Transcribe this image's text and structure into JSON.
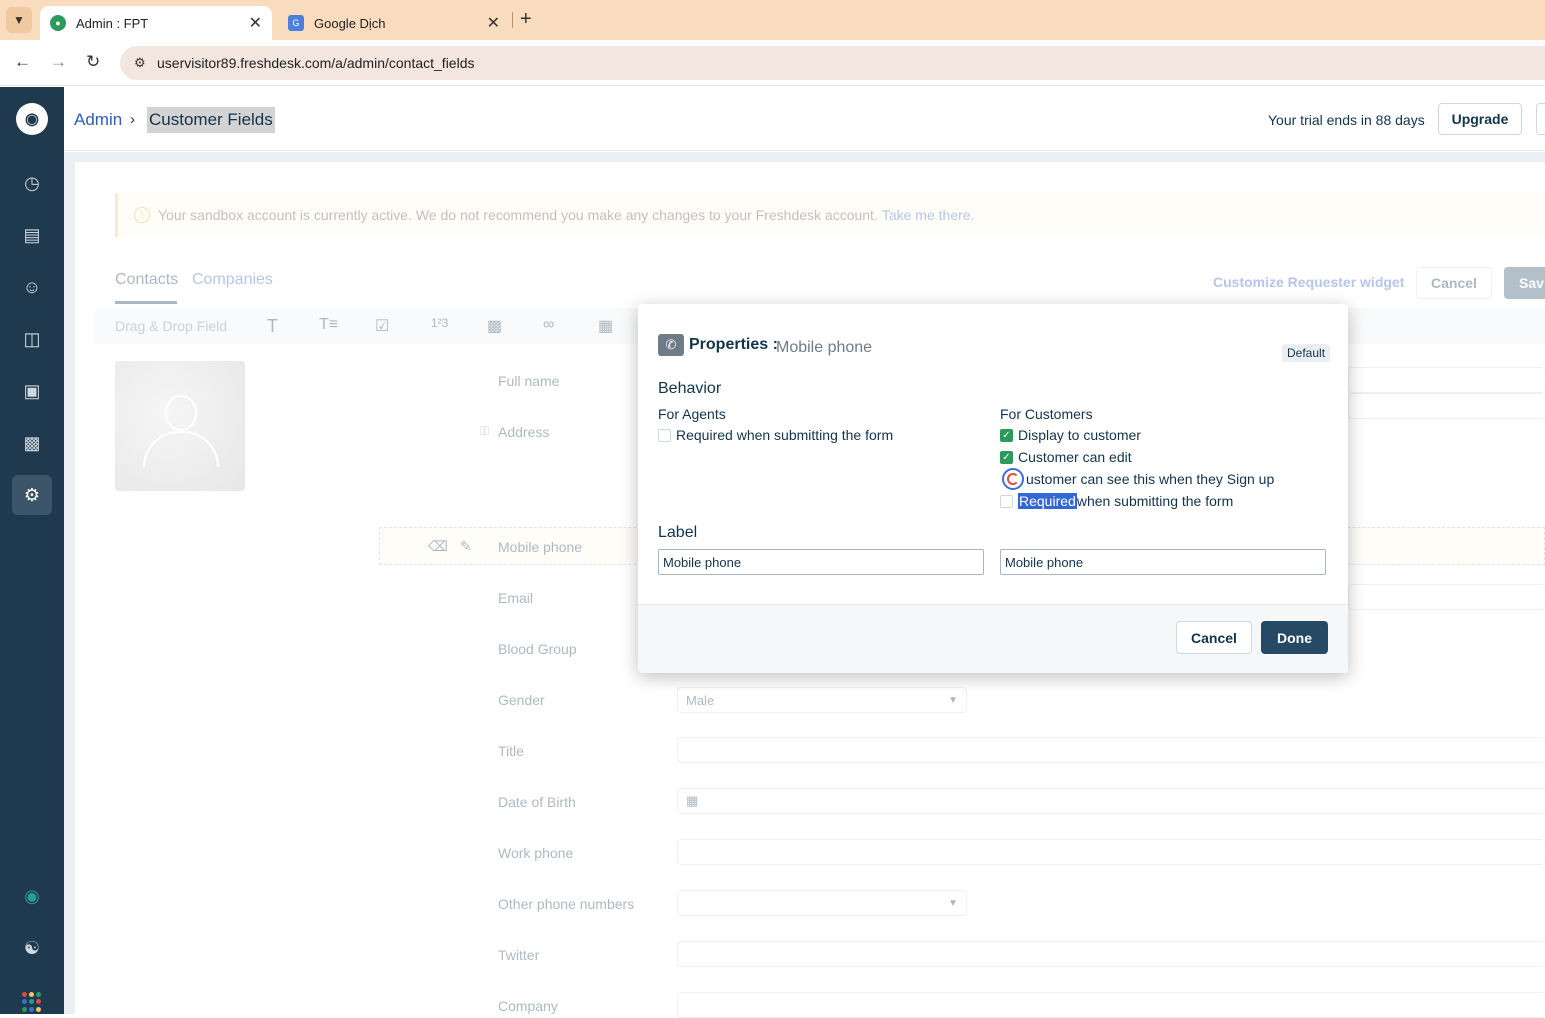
{
  "browser": {
    "tabs": [
      {
        "title": "Admin : FPT"
      },
      {
        "title": "Google Dịch"
      }
    ],
    "url": "uservisitor89.freshdesk.com/a/admin/contact_fields"
  },
  "header": {
    "breadcrumb_root": "Admin",
    "breadcrumb_current": "Customer Fields",
    "trial_text": "Your trial ends in 88 days",
    "upgrade_label": "Upgrade"
  },
  "sandbox_banner": {
    "text": "Your sandbox account is currently active. We do not recommend you make any changes to your Freshdesk account.",
    "link": "Take me there."
  },
  "tabs": {
    "contacts": "Contacts",
    "companies": "Companies"
  },
  "actions": {
    "customize_widget": "Customize Requester widget",
    "cancel": "Cancel",
    "save": "Sav"
  },
  "toolbar": {
    "drag_drop_label": "Drag & Drop Field"
  },
  "fields": [
    {
      "label": "Full name"
    },
    {
      "label": "Address"
    },
    {
      "label": "Mobile phone"
    },
    {
      "label": "Email"
    },
    {
      "label": "Blood Group"
    },
    {
      "label": "Gender",
      "value": "Male"
    },
    {
      "label": "Title"
    },
    {
      "label": "Date of Birth"
    },
    {
      "label": "Work phone"
    },
    {
      "label": "Other phone numbers"
    },
    {
      "label": "Twitter"
    },
    {
      "label": "Company"
    }
  ],
  "modal": {
    "title": "Properties :",
    "subtitle": "Mobile phone",
    "badge": "Default",
    "behavior_heading": "Behavior",
    "for_agents": "For Agents",
    "for_customers": "For Customers",
    "agent_required": "Required when submitting the form",
    "display_to_customer": "Display to customer",
    "customer_can_edit": "Customer can edit",
    "signup_text": "ustomer can see this when they Sign up",
    "required_word": "Required",
    "required_rest": " when submitting the form",
    "label_heading": "Label",
    "agent_label_value": "Mobile phone",
    "customer_label_value": "Mobile phone",
    "cancel_label": "Cancel",
    "done_label": "Done"
  },
  "colors": {
    "sidebar": "#1f3a4e",
    "primary_button": "#264966",
    "link": "#2c5cc5",
    "checkbox_checked": "#2b9a5b",
    "tab_strip": "#f9dcbd"
  }
}
